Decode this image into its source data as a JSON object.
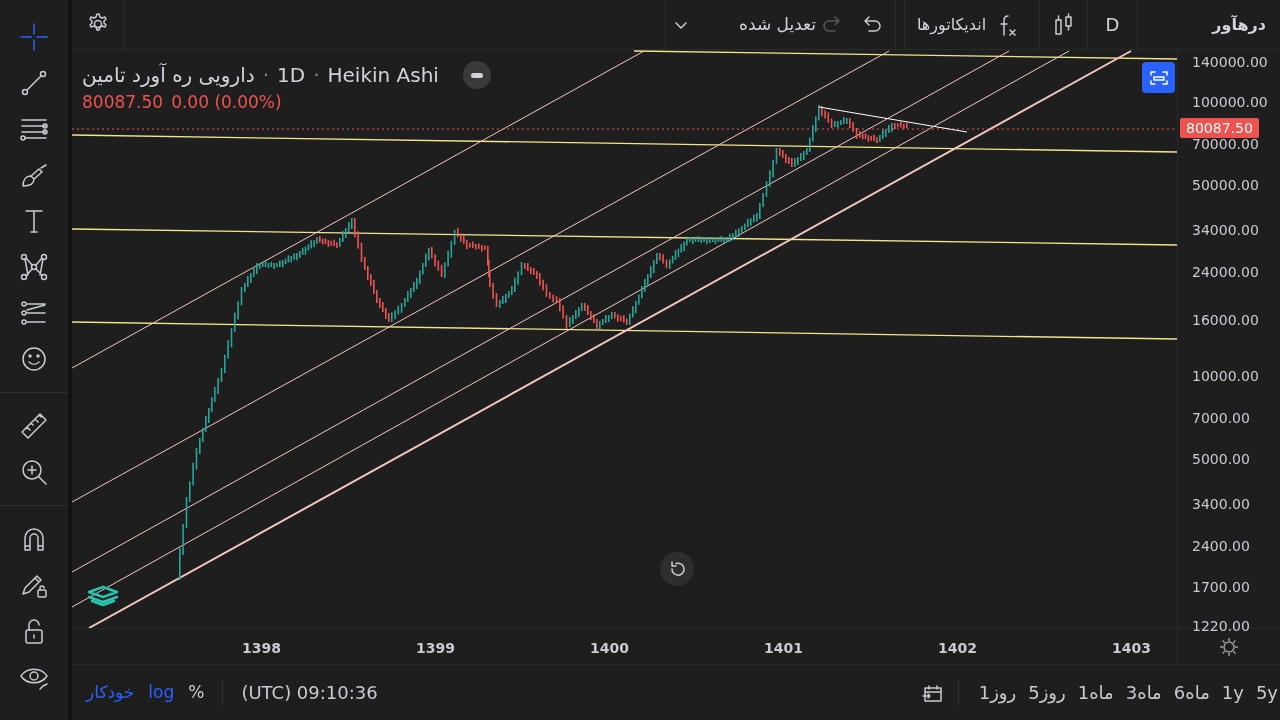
{
  "top_bar": {
    "symbol": "درهآور",
    "interval": "D",
    "indicators": "اندیکاتورها",
    "adjustment": "تعدیل شده",
    "redo_disabled": true
  },
  "legend": {
    "title": "دارویی ره آورد تامین",
    "separator": "·",
    "interval": "1D",
    "chart_type": "Heikin Ashi",
    "price": "80087.50",
    "change": "0.00 (0.00%)"
  },
  "price_axis": {
    "labels": [
      "140000.00",
      "100000.00",
      "70000.00",
      "50000.00",
      "34000.00",
      "24000.00",
      "16000.00",
      "10000.00",
      "7000.00",
      "5000.00",
      "3400.00",
      "2400.00",
      "1700.00",
      "1220.00"
    ],
    "last_price": "80087.50"
  },
  "time_axis": {
    "labels": [
      "1398",
      "1399",
      "1400",
      "1401",
      "1402",
      "1403"
    ]
  },
  "bottom_bar": {
    "scale_options": [
      {
        "label": "خودکار",
        "on": true
      },
      {
        "label": "log",
        "on": true
      },
      {
        "label": "%",
        "on": false
      }
    ],
    "time": "(UTC) 09:10:36",
    "ranges": [
      "5y",
      "1y",
      "6ماه",
      "3ماه",
      "1ماه",
      "5روز",
      "1روز"
    ]
  }
}
